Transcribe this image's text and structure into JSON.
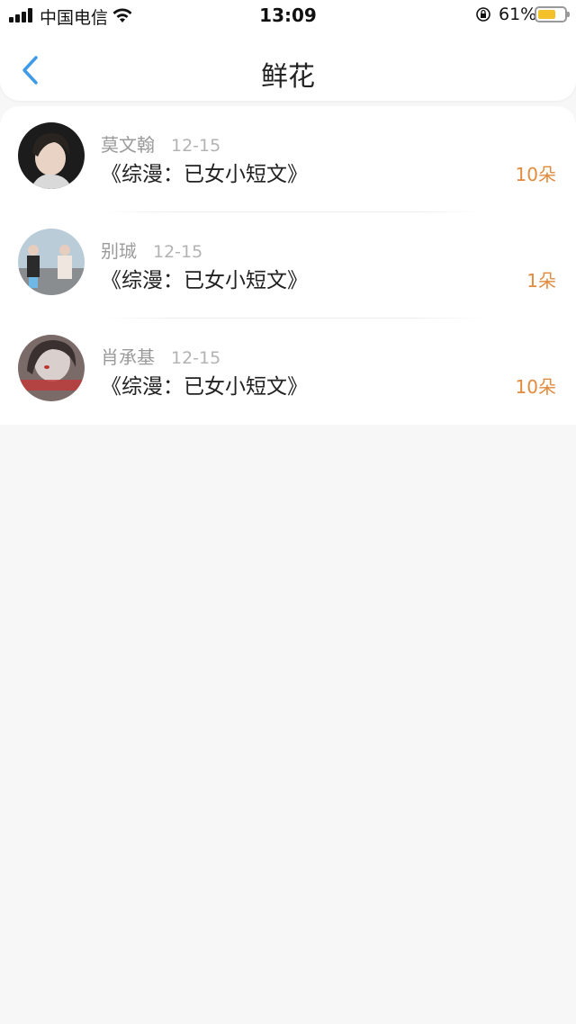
{
  "status_bar": {
    "carrier": "中国电信",
    "time": "13:09",
    "battery_percent": "61%",
    "battery_level": 0.61
  },
  "nav": {
    "title": "鲜花",
    "back_icon": "chevron-left-icon"
  },
  "colors": {
    "accent": "#3f9be6",
    "count": "#e28a3d",
    "battery": "#f3c22b"
  },
  "records": [
    {
      "name": "莫文翰",
      "date": "12-15",
      "book": "《综漫：已女小短文》",
      "count": "10朵"
    },
    {
      "name": "别珹",
      "date": "12-15",
      "book": "《综漫：已女小短文》",
      "count": "1朵"
    },
    {
      "name": "肖承基",
      "date": "12-15",
      "book": "《综漫：已女小短文》",
      "count": "10朵"
    }
  ]
}
